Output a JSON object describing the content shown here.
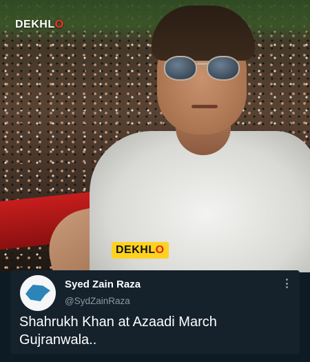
{
  "watermark": {
    "top_logo": {
      "prefix": "DEKHL",
      "o": "O"
    },
    "center_logo": {
      "prefix": "DEKHL",
      "o": "O"
    }
  },
  "tweet": {
    "display_name": "Syed Zain Raza",
    "handle": "@SydZainRaza",
    "line1": "Shahrukh Khan at Azaadi March",
    "line2": "Gujranwala..",
    "avatar_icon": "pakistan-map-icon",
    "menu_icon": "more-vertical-icon"
  },
  "colors": {
    "card_bg": "#15212b",
    "text": "#ffffff",
    "muted": "#8b98a5",
    "logo_yellow": "#ffd21f",
    "logo_red": "#e02020"
  }
}
